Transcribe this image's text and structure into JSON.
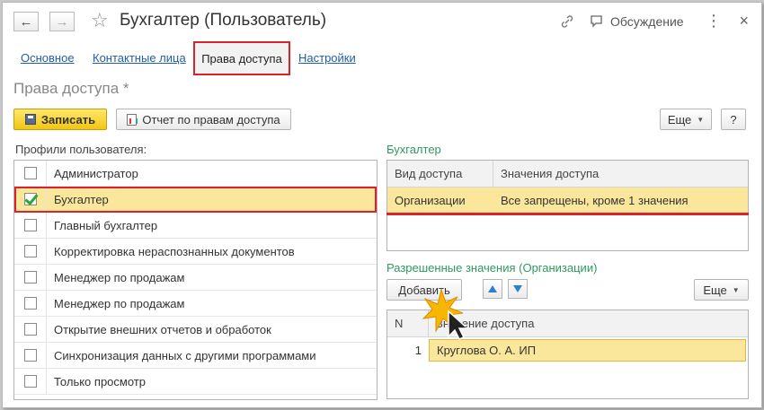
{
  "window": {
    "title": "Бухгалтер (Пользователь)",
    "discussion_label": "Обсуждение",
    "more_label": "⋮",
    "close_label": "×",
    "back_label": "←",
    "forward_label": "→",
    "star_label": "☆",
    "link_label": "🔗"
  },
  "tabs": [
    {
      "label": "Основное"
    },
    {
      "label": "Контактные лица"
    },
    {
      "label": "Права доступа",
      "active": true
    },
    {
      "label": "Настройки"
    }
  ],
  "section_title": "Права доступа *",
  "toolbar": {
    "save_label": "Записать",
    "report_label": "Отчет по правам доступа",
    "more_label": "Еще",
    "help_label": "?"
  },
  "profiles": {
    "label": "Профили пользователя:",
    "items": [
      {
        "label": "Администратор",
        "checked": false
      },
      {
        "label": "Бухгалтер",
        "checked": true
      },
      {
        "label": "Главный бухгалтер",
        "checked": false
      },
      {
        "label": "Корректировка нераспознанных документов",
        "checked": false
      },
      {
        "label": "Менеджер по продажам",
        "checked": false
      },
      {
        "label": "Менеджер по продажам",
        "checked": false
      },
      {
        "label": "Открытие внешних отчетов и обработок",
        "checked": false
      },
      {
        "label": "Синхронизация данных с другими программами",
        "checked": false
      },
      {
        "label": "Только просмотр",
        "checked": false
      }
    ]
  },
  "access_group": {
    "title": "Бухгалтер",
    "columns": [
      "Вид доступа",
      "Значения доступа"
    ],
    "rows": [
      {
        "kind": "Организации",
        "value": "Все запрещены, кроме 1 значения"
      }
    ]
  },
  "allowed_values": {
    "title": "Разрешенные значения (Организации)",
    "add_label": "Добавить",
    "more_label": "Еще",
    "columns": [
      "N",
      "Значение доступа"
    ],
    "rows": [
      {
        "n": "1",
        "value": "Круглова О. А. ИП"
      }
    ]
  },
  "colors": {
    "accent_red": "#d9222a",
    "selection_yellow": "#fbe79c",
    "link_blue": "#1f5ea8",
    "group_green": "#2e9a5e",
    "primary_button": "#f2c514"
  }
}
